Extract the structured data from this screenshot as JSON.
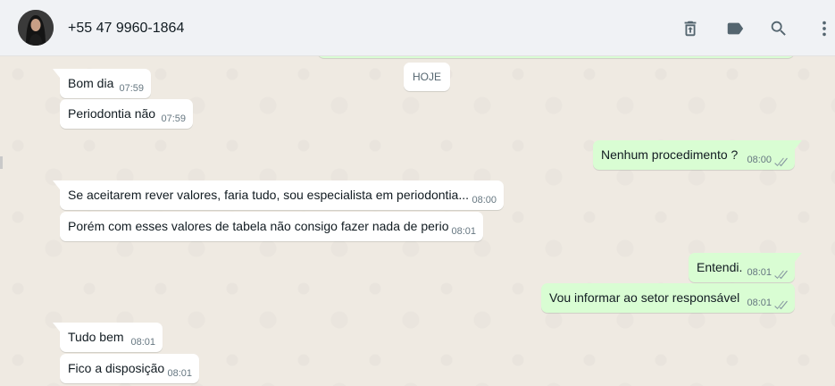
{
  "header": {
    "contact_name": "+55 47 9960-1864",
    "icons": [
      "delete-icon",
      "label-icon",
      "search-icon",
      "menu-icon"
    ]
  },
  "chat": {
    "day_separator": "HOJE",
    "messages": [
      {
        "direction": "in",
        "text": "Bom dia",
        "time": "07:59"
      },
      {
        "direction": "in",
        "text": "Periodontia não",
        "time": "07:59"
      },
      {
        "direction": "out",
        "text": "Nenhum procedimento ?",
        "time": "08:00",
        "status": "read"
      },
      {
        "direction": "in",
        "text": "Se aceitarem rever valores, faria tudo, sou especialista em periodontia...",
        "time": "08:00"
      },
      {
        "direction": "in",
        "text": "Porém com esses valores de tabela não consigo fazer nada de perio",
        "time": "08:01"
      },
      {
        "direction": "out",
        "text": "Entendi.",
        "time": "08:01",
        "status": "read"
      },
      {
        "direction": "out",
        "text": "Vou informar ao setor responsável",
        "time": "08:01",
        "status": "read"
      },
      {
        "direction": "in",
        "text": "Tudo bem",
        "time": "08:01"
      },
      {
        "direction": "in",
        "text": "Fico a disposição",
        "time": "08:01"
      }
    ]
  },
  "colors": {
    "incoming_bubble": "#ffffff",
    "outgoing_bubble": "#d9fdd3",
    "chat_background": "#efeae2",
    "header_background": "#f0f2f5",
    "read_ticks": "#8696a0"
  }
}
